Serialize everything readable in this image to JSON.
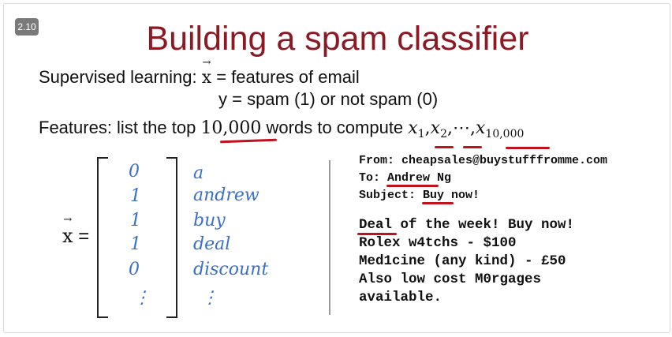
{
  "slide_number": "2.10",
  "title": "Building a spam classifier",
  "supervised": {
    "prefix": "Supervised learning: ",
    "x_symbol": "x",
    "x_def": " = features of email",
    "y_def": "y = spam (1) or not spam (0)"
  },
  "features": {
    "prefix": "Features: list the top ",
    "count": "10,000",
    "suffix": " words to compute ",
    "x1": "x",
    "x1_sub": "1",
    "comma1": ",",
    "x2": "x",
    "x2_sub": "2",
    "comma2": ",",
    "ellipsis": "⋯",
    "comma3": ",",
    "xn": "x",
    "xn_sub": "10,000"
  },
  "vector": {
    "label": "x",
    "equals": "=",
    "values": [
      "0",
      "1",
      "1",
      "1",
      "0",
      "⋮"
    ],
    "words": [
      "a",
      "andrew",
      "buy",
      "deal",
      "discount",
      "⋮"
    ]
  },
  "email": {
    "from": "From: cheapsales@buystufffromme.com",
    "to_prefix": "To: ",
    "to_name": "Andrew",
    "to_suffix": " Ng",
    "subject_prefix": "Subject: ",
    "subject_word": "Buy",
    "subject_suffix": " now!",
    "body": [
      "Deal of the week! Buy now!",
      "Rolex w4tchs - $100",
      "Med1cine (any kind) - £50",
      "Also low cost M0rgages",
      "available."
    ]
  },
  "colors": {
    "title": "#8b1a24",
    "annotation_red": "#c0111d",
    "handwriting_blue": "#3a6fc9"
  }
}
